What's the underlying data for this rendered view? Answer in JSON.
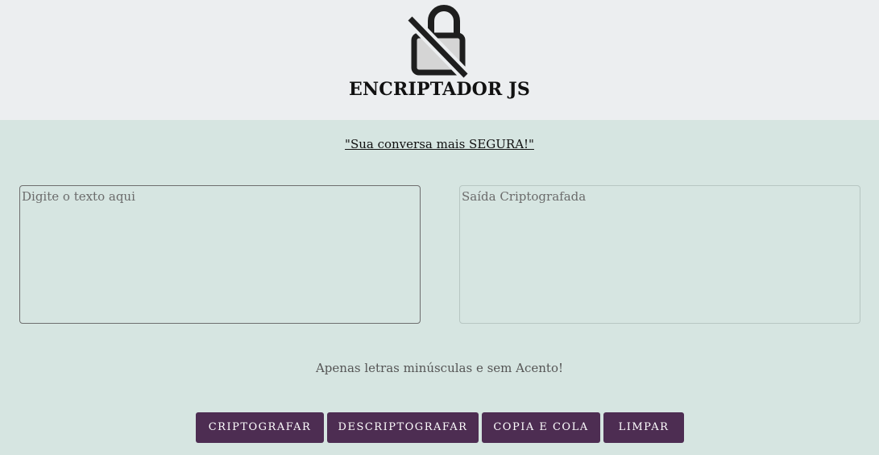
{
  "header": {
    "logo_icon": "unlocked-padlock-icon",
    "title": "ENCRIPTADOR JS"
  },
  "slogan": "\"Sua conversa mais SEGURA!\"",
  "input": {
    "placeholder": "Digite o texto aqui",
    "value": ""
  },
  "output": {
    "placeholder": "Saída Criptografada",
    "value": ""
  },
  "hint": "Apenas letras minúsculas e sem Acento!",
  "buttons": {
    "encrypt": "CRIPTOGRAFAR",
    "decrypt": "DESCRIPTOGRAFAR",
    "copy": "COPIA E COLA",
    "clear": "LIMPAR"
  },
  "colors": {
    "header_bg": "#eceef0",
    "page_bg": "#d6e5e1",
    "button_bg": "#4d2d52"
  }
}
